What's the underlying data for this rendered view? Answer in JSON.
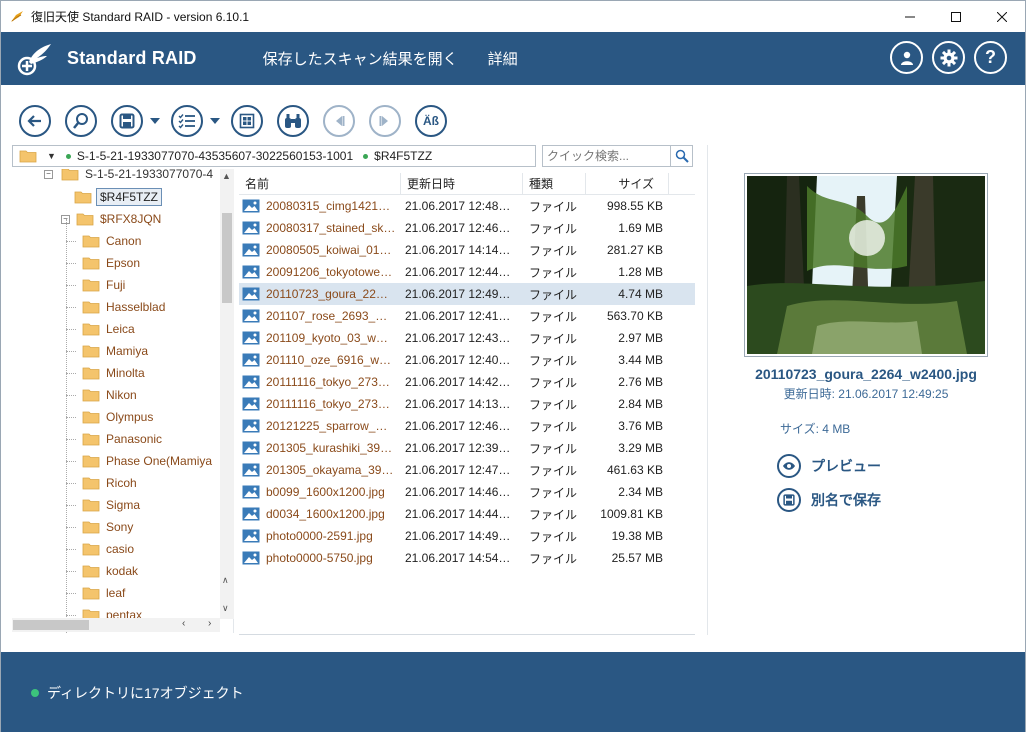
{
  "window": {
    "title": "復旧天使 Standard RAID - version 6.10.1"
  },
  "header": {
    "logo_text": "Standard RAID",
    "menu": [
      "保存したスキャン結果を開く",
      "詳細"
    ]
  },
  "path": {
    "segments": [
      "S-1-5-21-1933077070-43535607-3022560153-1001",
      "$R4F5TZZ"
    ]
  },
  "search": {
    "placeholder": "クイック検索..."
  },
  "tree": {
    "root_partial": "S-1-5-21-1933077070-4",
    "selected": "$R4F5TZZ",
    "parent": "$RFX8JQN",
    "folders": [
      "Canon",
      "Epson",
      "Fuji",
      "Hasselblad",
      "Leica",
      "Mamiya",
      "Minolta",
      "Nikon",
      "Olympus",
      "Panasonic",
      "Phase One(Mamiya",
      "Ricoh",
      "Sigma",
      "Sony",
      "casio",
      "kodak",
      "leaf",
      "pentax"
    ]
  },
  "file_list": {
    "columns": [
      "名前",
      "更新日時",
      "種類",
      "サイズ"
    ],
    "rows": [
      {
        "name": "20080315_cimg1421…",
        "date": "21.06.2017 12:48…",
        "type": "ファイル",
        "size": "998.55 KB"
      },
      {
        "name": "20080317_stained_sk…",
        "date": "21.06.2017 12:46…",
        "type": "ファイル",
        "size": "1.69 MB"
      },
      {
        "name": "20080505_koiwai_01…",
        "date": "21.06.2017 14:14…",
        "type": "ファイル",
        "size": "281.27 KB"
      },
      {
        "name": "20091206_tokyotowe…",
        "date": "21.06.2017 12:44…",
        "type": "ファイル",
        "size": "1.28 MB"
      },
      {
        "name": "20110723_goura_22…",
        "date": "21.06.2017 12:49…",
        "type": "ファイル",
        "size": "4.74 MB"
      },
      {
        "name": "201107_rose_2693_…",
        "date": "21.06.2017 12:41…",
        "type": "ファイル",
        "size": "563.70 KB"
      },
      {
        "name": "201109_kyoto_03_w…",
        "date": "21.06.2017 12:43…",
        "type": "ファイル",
        "size": "2.97 MB"
      },
      {
        "name": "201110_oze_6916_w…",
        "date": "21.06.2017 12:40…",
        "type": "ファイル",
        "size": "3.44 MB"
      },
      {
        "name": "20111116_tokyo_273…",
        "date": "21.06.2017 14:42…",
        "type": "ファイル",
        "size": "2.76 MB"
      },
      {
        "name": "20111116_tokyo_273…",
        "date": "21.06.2017 14:13…",
        "type": "ファイル",
        "size": "2.84 MB"
      },
      {
        "name": "20121225_sparrow_…",
        "date": "21.06.2017 12:46…",
        "type": "ファイル",
        "size": "3.76 MB"
      },
      {
        "name": "201305_kurashiki_39…",
        "date": "21.06.2017 12:39…",
        "type": "ファイル",
        "size": "3.29 MB"
      },
      {
        "name": "201305_okayama_39…",
        "date": "21.06.2017 12:47…",
        "type": "ファイル",
        "size": "461.63 KB"
      },
      {
        "name": "b0099_1600x1200.jpg",
        "date": "21.06.2017 14:46…",
        "type": "ファイル",
        "size": "2.34 MB"
      },
      {
        "name": "d0034_1600x1200.jpg",
        "date": "21.06.2017 14:44…",
        "type": "ファイル",
        "size": "1009.81 KB"
      },
      {
        "name": "photo0000-2591.jpg",
        "date": "21.06.2017 14:49…",
        "type": "ファイル",
        "size": "19.38 MB"
      },
      {
        "name": "photo0000-5750.jpg",
        "date": "21.06.2017 14:54…",
        "type": "ファイル",
        "size": "25.57 MB"
      }
    ],
    "selected_index": 4
  },
  "preview": {
    "file_name": "20110723_goura_2264_w2400.jpg",
    "modified": "更新日時: 21.06.2017 12:49:25",
    "size": "サイズ: 4 MB",
    "preview_label": "プレビュー",
    "save_as_label": "別名で保存"
  },
  "status": {
    "text": "ディレクトリに17オブジェクト"
  }
}
